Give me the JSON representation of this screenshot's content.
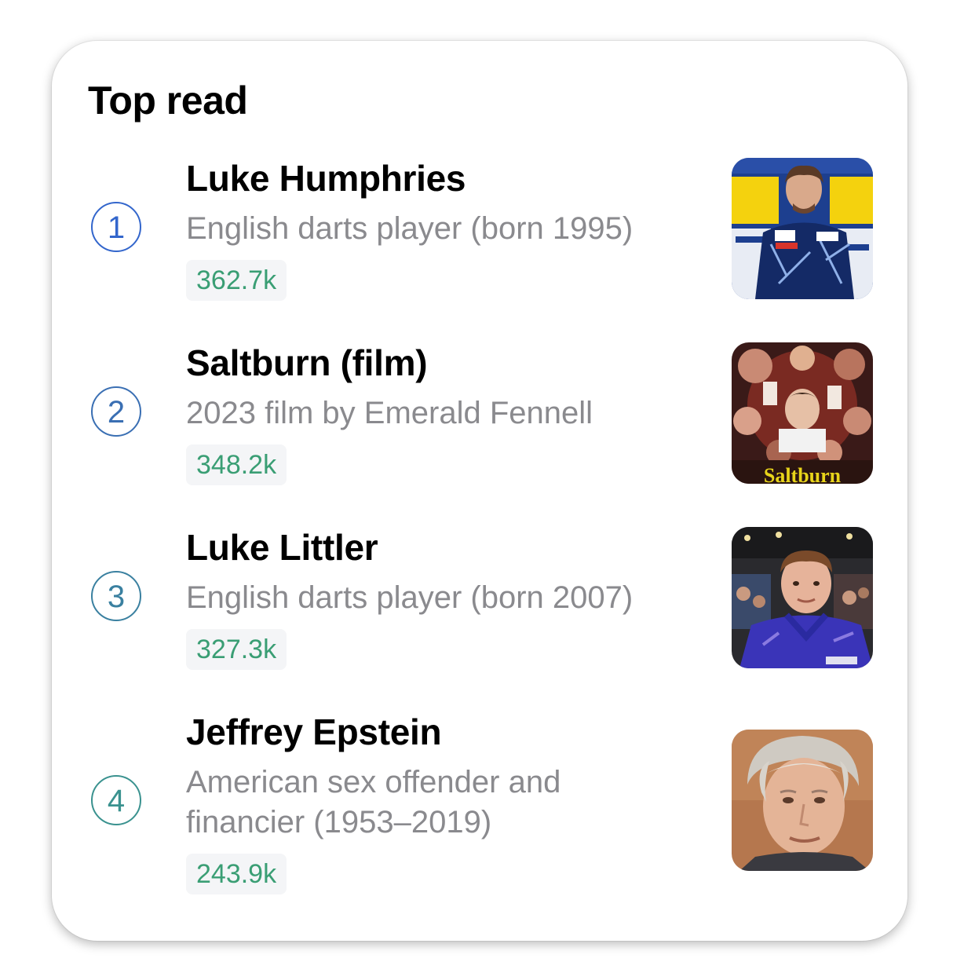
{
  "widget": {
    "title": "Top read",
    "items": [
      {
        "rank": "1",
        "title": "Luke Humphries",
        "description": "English darts player (born 1995)",
        "views": "362.7k",
        "rank_color": "#3366cc",
        "thumbnail": "darts-player-photo"
      },
      {
        "rank": "2",
        "title": "Saltburn (film)",
        "description": "2023 film by Emerald Fennell",
        "views": "348.2k",
        "rank_color": "#3a6fb3",
        "thumbnail": "film-poster",
        "thumbnail_text": "Saltburn"
      },
      {
        "rank": "3",
        "title": "Luke Littler",
        "description": "English darts player (born 2007)",
        "views": "327.3k",
        "rank_color": "#3a80a0",
        "thumbnail": "darts-player-photo"
      },
      {
        "rank": "4",
        "title": "Jeffrey Epstein",
        "description": "American sex offender and financier (1953–2019)",
        "views": "243.9k",
        "rank_color": "#3a928f",
        "thumbnail": "portrait-photo"
      }
    ]
  },
  "colors": {
    "views_text": "#3a9e74",
    "views_bg": "#f4f5f7",
    "description": "#8a8a8e"
  }
}
